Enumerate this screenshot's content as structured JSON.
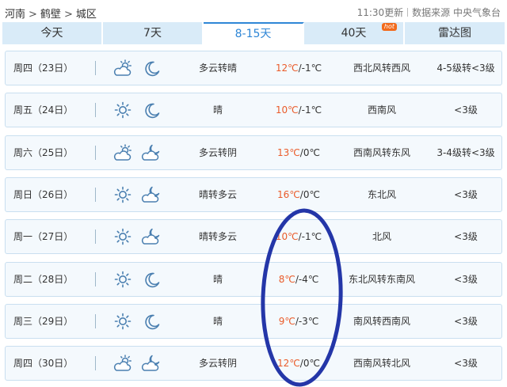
{
  "breadcrumb": {
    "items": [
      "河南",
      "鹤壁",
      "城区"
    ],
    "separator": ">"
  },
  "meta": {
    "update_time": "11:30更新",
    "source_label": "数据来源 中央气象台"
  },
  "tabs": [
    {
      "label": "今天",
      "active": false
    },
    {
      "label": "7天",
      "active": false
    },
    {
      "label": "8-15天",
      "active": true
    },
    {
      "label": "40天",
      "active": false,
      "badge": "hot"
    },
    {
      "label": "雷达图",
      "active": false
    }
  ],
  "colors": {
    "accent": "#2e86d6",
    "high_temp": "#ea5c2b",
    "tab_bg": "#d9ebf8",
    "row_bg": "#f4f9fd",
    "annotation_oval": "#2436a8"
  },
  "forecast": [
    {
      "day": "周四（23日）",
      "day_icon": "cloudy-sun-icon",
      "night_icon": "moon-icon",
      "desc": "多云转晴",
      "high": "12℃",
      "low": "/-1℃",
      "wind": "西北风转西风",
      "level": "4-5级转<3级"
    },
    {
      "day": "周五（24日）",
      "day_icon": "sun-icon",
      "night_icon": "moon-icon",
      "desc": "晴",
      "high": "10℃",
      "low": "/-1℃",
      "wind": "西南风",
      "level": "<3级"
    },
    {
      "day": "周六（25日）",
      "day_icon": "cloudy-sun-icon",
      "night_icon": "cloudy-moon-icon",
      "desc": "多云转阴",
      "high": "13℃",
      "low": "/0℃",
      "wind": "西南风转东风",
      "level": "3-4级转<3级"
    },
    {
      "day": "周日（26日）",
      "day_icon": "sun-icon",
      "night_icon": "cloudy-moon-icon",
      "desc": "晴转多云",
      "high": "16℃",
      "low": "/0℃",
      "wind": "东北风",
      "level": "<3级"
    },
    {
      "day": "周一（27日）",
      "day_icon": "sun-icon",
      "night_icon": "cloudy-moon-icon",
      "desc": "晴转多云",
      "high": "10℃",
      "low": "/-1℃",
      "wind": "北风",
      "level": "<3级"
    },
    {
      "day": "周二（28日）",
      "day_icon": "sun-icon",
      "night_icon": "moon-icon",
      "desc": "晴",
      "high": "8℃",
      "low": "/-4℃",
      "wind": "东北风转东南风",
      "level": "<3级"
    },
    {
      "day": "周三（29日）",
      "day_icon": "sun-icon",
      "night_icon": "moon-icon",
      "desc": "晴",
      "high": "9℃",
      "low": "/-3℃",
      "wind": "南风转西南风",
      "level": "<3级"
    },
    {
      "day": "周四（30日）",
      "day_icon": "cloudy-sun-icon",
      "night_icon": "cloudy-moon-icon",
      "desc": "多云转阴",
      "high": "12℃",
      "low": "/0℃",
      "wind": "西南风转北风",
      "level": "<3级"
    }
  ]
}
